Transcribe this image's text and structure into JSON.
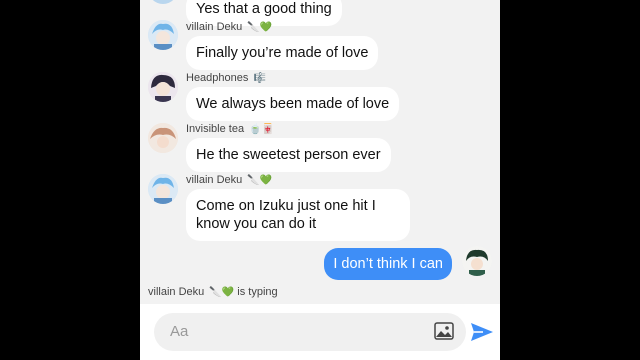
{
  "messages": [
    {
      "sender": "",
      "text": "Yes that a good thing"
    },
    {
      "sender": "villain Deku",
      "sender_emoji": "🔪💚",
      "text": "Finally you’re made of love"
    },
    {
      "sender": "Headphones",
      "sender_emoji": "🎼",
      "text": "We always been made of love"
    },
    {
      "sender": "Invisible tea",
      "sender_emoji": "🍵🀄",
      "text": "He the sweetest person ever"
    },
    {
      "sender": "villain Deku",
      "sender_emoji": "🔪💚",
      "text": "Come on Izuku just one hit I know you can do it"
    }
  ],
  "outgoing": {
    "text": "I don’t think I can"
  },
  "typing": {
    "name": "villain Deku",
    "emoji": "🔪💚",
    "suffix": "is typing"
  },
  "composer": {
    "placeholder": "Aa"
  },
  "colors": {
    "outgoing_bubble": "#3e8ef7",
    "send_icon": "#3e8ef7",
    "screen_bg": "#f2f2f2"
  }
}
